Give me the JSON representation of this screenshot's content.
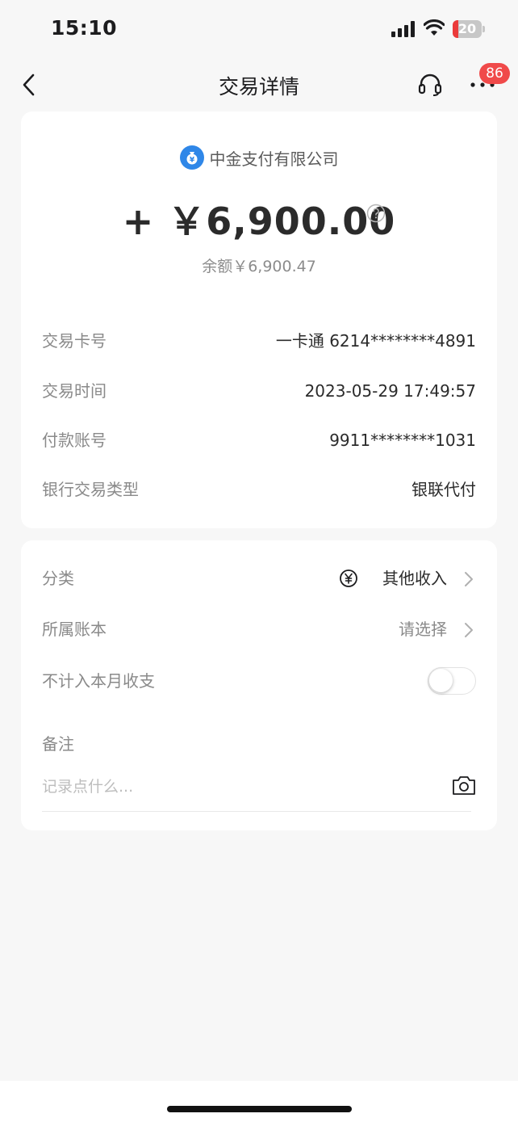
{
  "status_bar": {
    "time": "15:10",
    "battery": "20",
    "battery_level": 0.2
  },
  "nav": {
    "title": "交易详情",
    "more_badge": "86"
  },
  "summary": {
    "merchant": "中金支付有限公司",
    "amount": "+ ￥6,900.00",
    "balance": "余额￥6,900.47"
  },
  "details": [
    {
      "label": "交易卡号",
      "value": "一卡通 6214********4891"
    },
    {
      "label": "交易时间",
      "value": "2023-05-29 17:49:57"
    },
    {
      "label": "付款账号",
      "value": "9911********1031"
    },
    {
      "label": "银行交易类型",
      "value": "银联代付"
    }
  ],
  "settings": {
    "category_label": "分类",
    "category_value": "其他收入",
    "book_label": "所属账本",
    "book_value": "请选择",
    "exclude_label": "不计入本月收支",
    "exclude_on": false,
    "note_label": "备注",
    "note_placeholder": "记录点什么..."
  },
  "icons": {
    "back": "back-icon",
    "headset": "headset-icon",
    "more": "more-icon",
    "merchant": "money-bag-icon",
    "help": "question-icon",
    "category": "yuan-icon",
    "chevron": "chevron-right-icon",
    "camera": "camera-icon"
  },
  "colors": {
    "accent_blue": "#2f87e8",
    "badge_red": "#f04a4a",
    "battery_red": "#eb3b3b",
    "background": "#f7f7f7"
  }
}
